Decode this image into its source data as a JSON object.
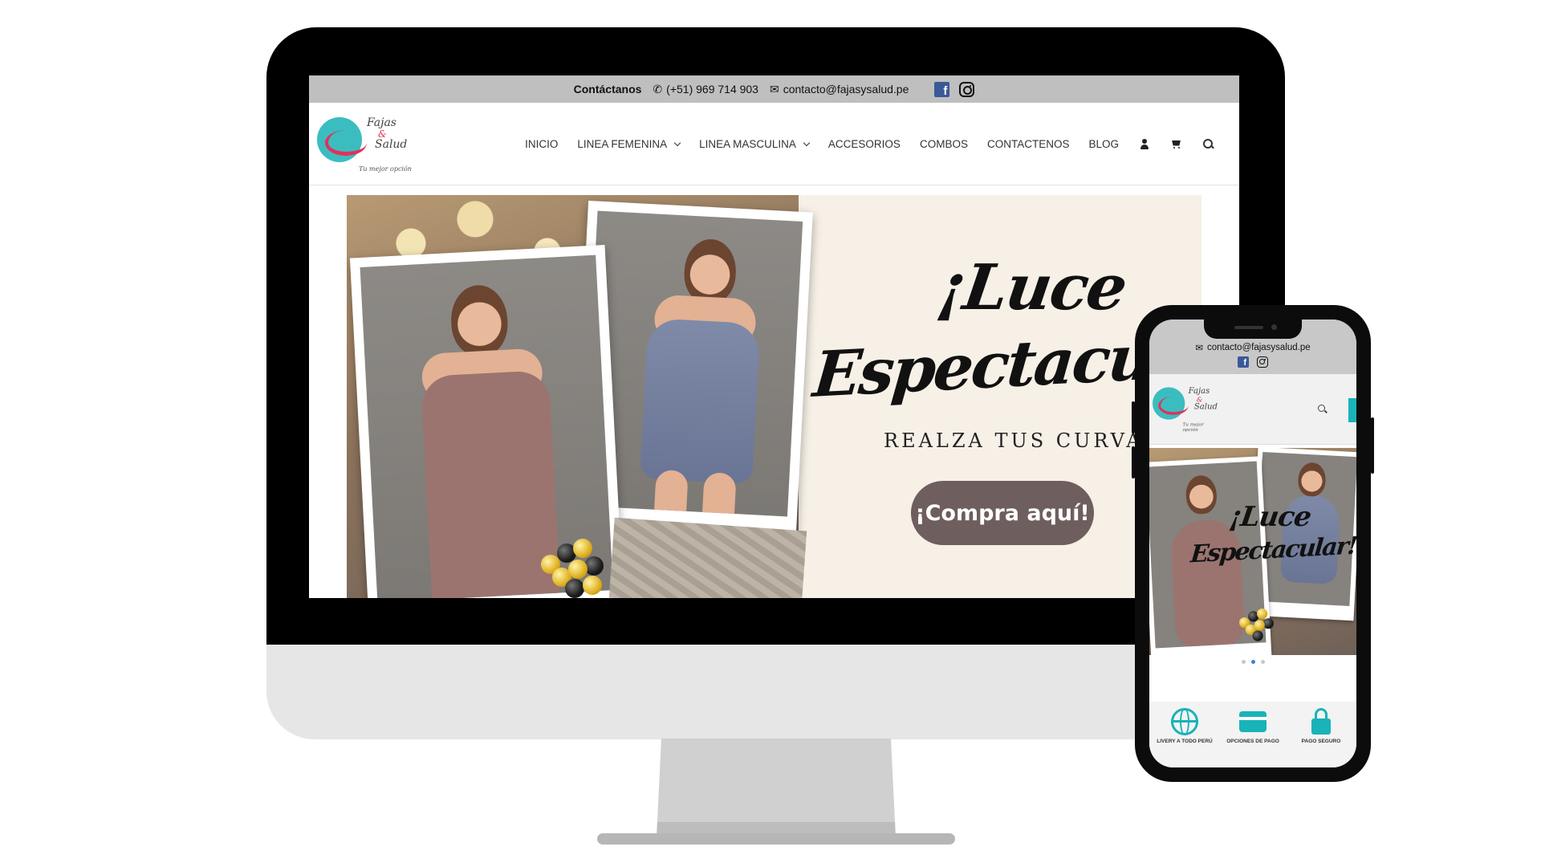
{
  "desktop": {
    "topbar": {
      "label": "Contáctanos",
      "phone_icon": "phone-icon",
      "phone": "(+51) 969 714 903",
      "email_icon": "mail-icon",
      "email": "contacto@fajasysalud.pe",
      "social": [
        "facebook-icon",
        "instagram-icon"
      ]
    },
    "logo": {
      "line1": "Fajas",
      "amp": "&",
      "line2": "Salud",
      "tagline": "Tu mejor opción"
    },
    "nav": {
      "items": [
        {
          "label": "INICIO"
        },
        {
          "label": "LINEA FEMENINA"
        },
        {
          "label": "LINEA MASCULINA"
        },
        {
          "label": "ACCESORIOS"
        },
        {
          "label": "COMBOS"
        },
        {
          "label": "CONTACTENOS"
        },
        {
          "label": "BLOG"
        }
      ],
      "icons": [
        "user-icon",
        "cart-icon",
        "search-icon"
      ]
    },
    "hero": {
      "headline_1": "¡Luce",
      "headline_2": "Espectacula",
      "tagline": "REALZA TUS CURVAS",
      "cta": "¡Compra aquí!",
      "cta_color": "#6e5e5d"
    }
  },
  "mobile": {
    "email": "contacto@fajasysalud.pe",
    "logo": {
      "line1": "Fajas",
      "amp": "&",
      "line2": "Salud",
      "tagline": "Tu mejor opción"
    },
    "hero": {
      "headline_1": "¡Luce",
      "headline_2": "Espectacular!"
    },
    "slider": {
      "count": 3,
      "active": 2
    },
    "features": [
      {
        "icon": "globe-icon",
        "title": "LIVERY A TODO PERÚ"
      },
      {
        "icon": "credit-card-icon",
        "title": "OPCIONES DE PAGO"
      },
      {
        "icon": "lock-icon",
        "title": "PAGO SEGURO"
      }
    ],
    "accent": "#19b3b8"
  }
}
